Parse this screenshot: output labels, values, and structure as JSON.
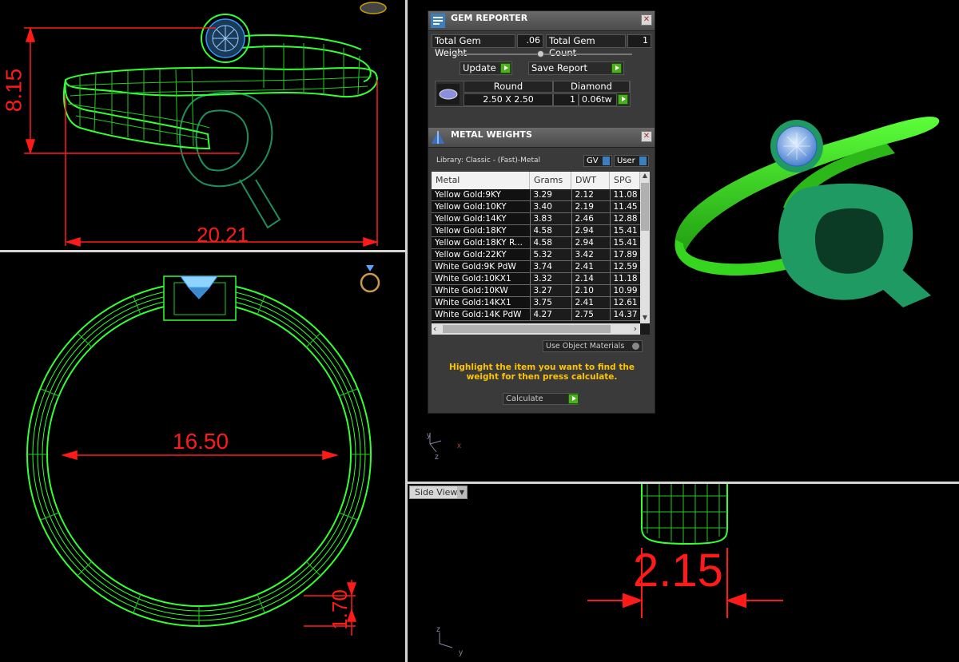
{
  "viewports": {
    "top_left": {
      "dim_height": "8.15",
      "dim_width": "20.21"
    },
    "bottom_left": {
      "dim_diameter": "16.50",
      "dim_thickness": "1.70"
    },
    "bottom_right": {
      "view_label": "Side View",
      "dim_width": "2.15",
      "axis_up": "z",
      "axis_right": "y"
    },
    "top_right": {
      "axis_up": "y",
      "axis_right": "x",
      "axis_depth": "z"
    }
  },
  "gem_reporter": {
    "title": "GEM REPORTER",
    "total_weight_label": "Total Gem Weight",
    "total_weight_value": ".06",
    "total_count_label": "Total Gem Count",
    "total_count_value": "1",
    "update_label": "Update",
    "save_report_label": "Save Report",
    "gem": {
      "shape": "Round",
      "type": "Diamond",
      "size": "2.50 X 2.50",
      "count": "1",
      "weight": "0.06tw"
    }
  },
  "metal_weights": {
    "title": "METAL WEIGHTS",
    "library": "Library: Classic - (Fast)-Metal",
    "gv_label": "GV",
    "user_label": "User",
    "columns": [
      "Metal",
      "Grams",
      "DWT",
      "SPG"
    ],
    "rows": [
      [
        "Yellow Gold:9KY",
        "3.29",
        "2.12",
        "11.08"
      ],
      [
        "Yellow Gold:10KY",
        "3.40",
        "2.19",
        "11.45"
      ],
      [
        "Yellow Gold:14KY",
        "3.83",
        "2.46",
        "12.88"
      ],
      [
        "Yellow Gold:18KY",
        "4.58",
        "2.94",
        "15.41"
      ],
      [
        "Yellow Gold:18KY R...",
        "4.58",
        "2.94",
        "15.41"
      ],
      [
        "Yellow Gold:22KY",
        "5.32",
        "3.42",
        "17.89"
      ],
      [
        "White Gold:9K PdW",
        "3.74",
        "2.41",
        "12.59"
      ],
      [
        "White Gold:10KX1",
        "3.32",
        "2.14",
        "11.18"
      ],
      [
        "White Gold:10KW",
        "3.27",
        "2.10",
        "10.99"
      ],
      [
        "White Gold:14KX1",
        "3.75",
        "2.41",
        "12.61"
      ],
      [
        "White Gold:14K PdW",
        "4.27",
        "2.75",
        "14.37"
      ]
    ],
    "use_object_materials": "Use Object Materials",
    "hint": "Highlight the item you want to find the weight for then press calculate.",
    "calculate_label": "Calculate"
  },
  "colors": {
    "wire": "#33ff33",
    "dimension": "#ff1a1a",
    "panel": "#3a3a3a",
    "hint": "#ffc400"
  }
}
